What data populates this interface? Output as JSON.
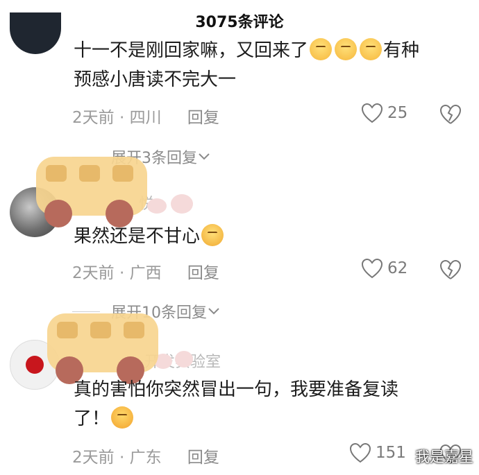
{
  "header": {
    "title": "3075条评论"
  },
  "comments": [
    {
      "text_line1": "十一不是刚回家嘛，又回来了",
      "text_suffix": "有种",
      "text_line2": "预感小唐读不完大一",
      "time": "2天前",
      "location": "四川",
      "reply_label": "回复",
      "likes": "25",
      "expand_label": "展开3条回复"
    },
    {
      "username_partial": "悦",
      "text_line1": "果然还是不甘心",
      "time": "2天前",
      "location": "广西",
      "reply_label": "回复",
      "likes": "62",
      "expand_label": "展开10条回复"
    },
    {
      "username_partial": "开发实验室",
      "text_line1": "真的害怕你突然冒出一句，我要准备复读",
      "text_line2": "了！",
      "time": "2天前",
      "location": "广东",
      "reply_label": "回复",
      "likes": "151"
    }
  ],
  "icons": {
    "heart": "heart-icon",
    "dislike": "broken-heart-icon",
    "chevron": "chevron-down-icon"
  },
  "watermark": "我是嘉星"
}
